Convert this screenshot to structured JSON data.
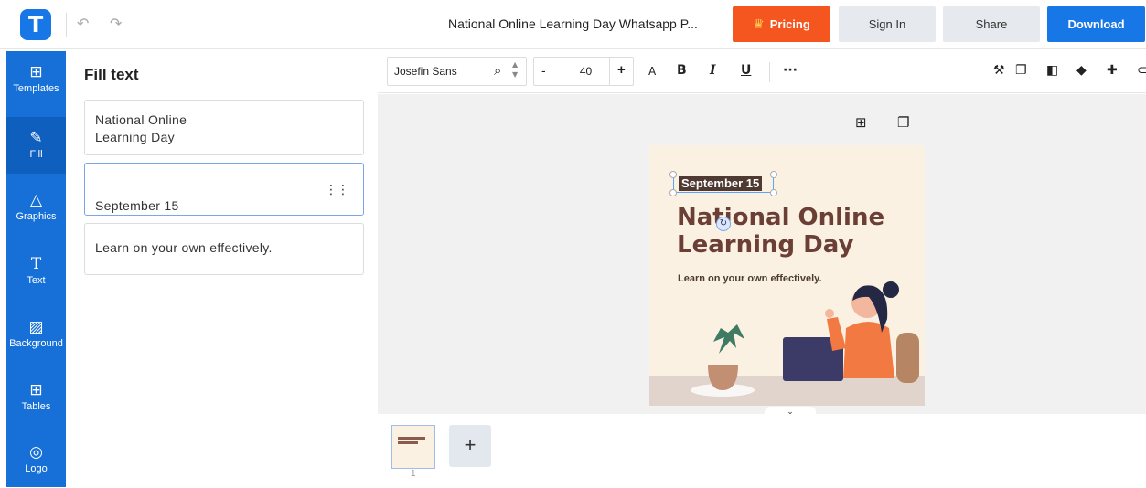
{
  "app": {
    "logo_letter": "T",
    "undo_icon": "↶",
    "redo_icon": "↷"
  },
  "header": {
    "title": "National Online Learning Day Whatsapp P...",
    "pricing_label": "Pricing",
    "signin_label": "Sign In",
    "share_label": "Share",
    "download_label": "Download"
  },
  "colors": {
    "accent": "#1670d7",
    "pricing": "#f5551e",
    "download": "#1877e6"
  },
  "sidebar": {
    "items": [
      {
        "label": "Templates",
        "icon": "templates-icon"
      },
      {
        "label": "Fill",
        "icon": "pencil-icon"
      },
      {
        "label": "Graphics",
        "icon": "graphics-icon"
      },
      {
        "label": "Text",
        "icon": "text-icon"
      },
      {
        "label": "Background",
        "icon": "background-icon"
      },
      {
        "label": "Tables",
        "icon": "tables-icon"
      },
      {
        "label": "Logo",
        "icon": "logo-icon"
      }
    ]
  },
  "fill_panel": {
    "title": "Fill text",
    "fields": [
      "National Online\nLearning Day",
      "September 15",
      "Learn on your own effectively."
    ]
  },
  "toolbar": {
    "font_family": "Josefin Sans",
    "font_size": "40",
    "decrease": "-",
    "increase": "+",
    "text_case": "A",
    "bold": "B",
    "italic": "I",
    "underline": "U",
    "more": "···"
  },
  "design": {
    "date": "September 15",
    "title_line1": "National Online",
    "title_line2": "Learning Day",
    "subtitle": "Learn on your own effectively."
  },
  "pages": {
    "current": "1",
    "add": "+"
  }
}
